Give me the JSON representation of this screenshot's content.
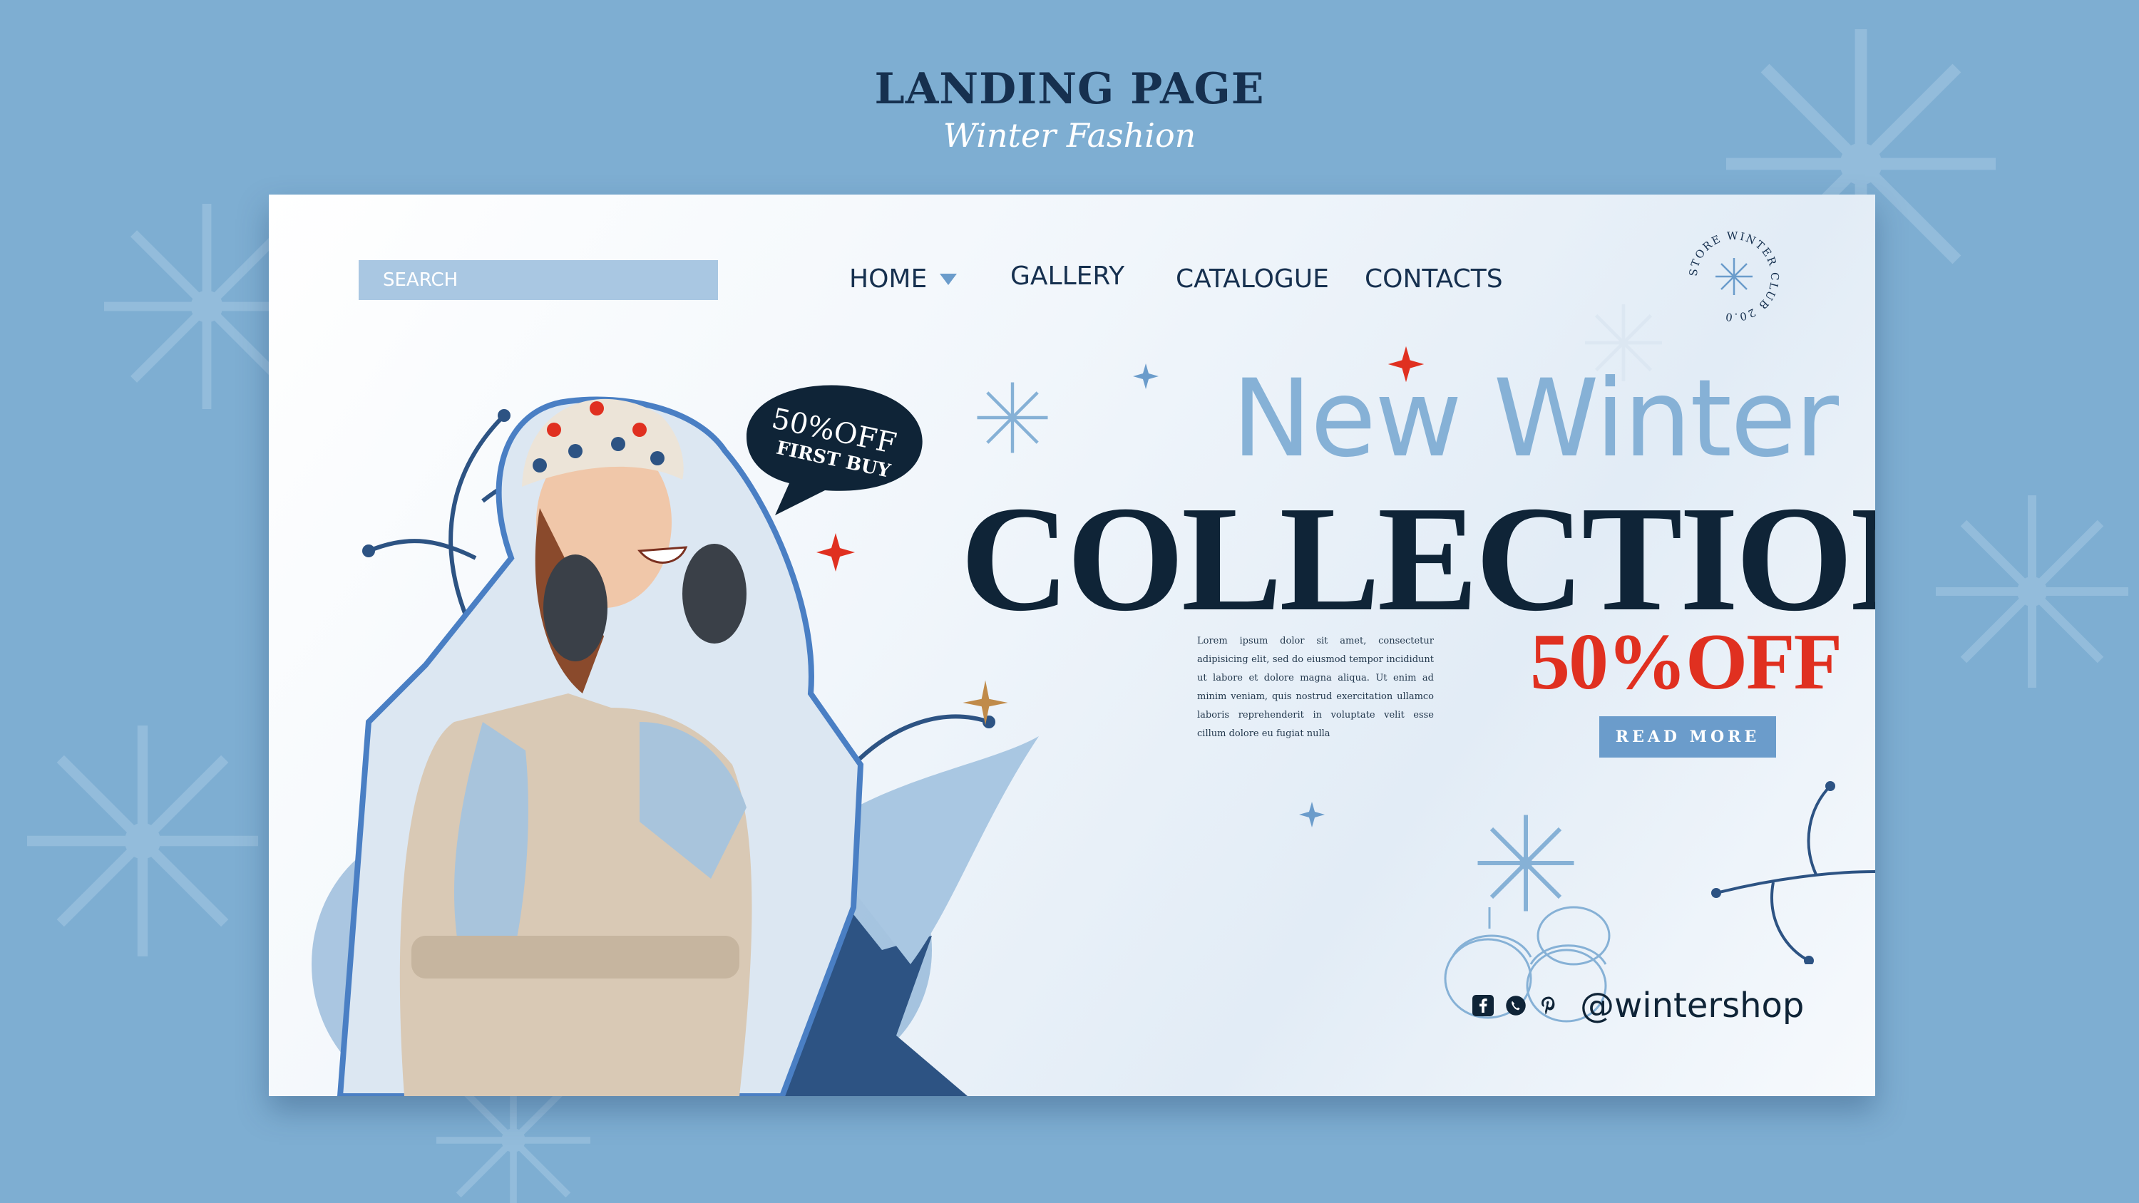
{
  "page": {
    "title": "LANDING PAGE",
    "subtitle": "Winter Fashion"
  },
  "search": {
    "placeholder": "SEARCH"
  },
  "nav": {
    "home": "HOME",
    "gallery": "GALLERY",
    "catalogue": "CATALOGUE",
    "contacts": "CONTACTS"
  },
  "badge": {
    "text": "STORE WINTER CLUB 20.0"
  },
  "promo_bubble": {
    "line1": "50%OFF",
    "line2": "FIRST BUY"
  },
  "hero": {
    "headline_top": "New Winter",
    "headline_main": "COLLECTION",
    "body": "Lorem ipsum dolor sit amet, consectetur adipisicing elit, sed do eiusmod tempor incididunt ut labore et dolore magna aliqua. Ut enim ad minim veniam, quis nostrud exercitation ullamco laboris reprehenderit in voluptate velit esse cillum dolore eu fugiat nulla",
    "discount": "50%OFF",
    "cta": "READ MORE"
  },
  "social": {
    "icons": [
      "facebook-icon",
      "whatsapp-icon",
      "pinterest-icon"
    ],
    "handle": "@wintershop"
  },
  "colors": {
    "background": "#7eaed2",
    "navy": "#0f2437",
    "light_blue": "#86b1d6",
    "accent_red": "#e03020",
    "button_blue": "#6b9ccb"
  }
}
